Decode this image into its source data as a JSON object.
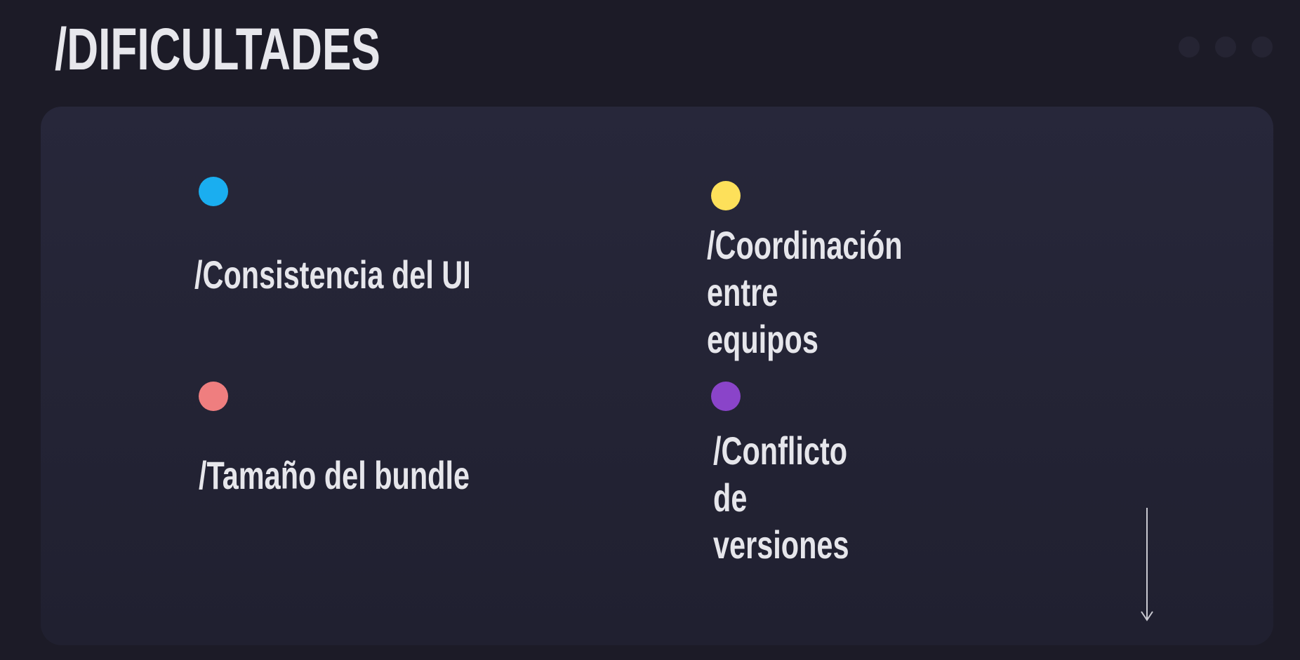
{
  "title": "/DIFICULTADES",
  "items": [
    {
      "label": "/Consistencia del UI",
      "color": "#1aaef0"
    },
    {
      "label": "/Coordinación entre\nequipos",
      "color": "#fde05a"
    },
    {
      "label": "/Tamaño del bundle",
      "color": "#ef7e7f"
    },
    {
      "label": "/Conflicto de\nversiones",
      "color": "#8a44c9"
    }
  ],
  "icons": {
    "window_dots": [
      "dot-icon",
      "dot-icon",
      "dot-icon"
    ],
    "scroll": "arrow-down-icon"
  }
}
